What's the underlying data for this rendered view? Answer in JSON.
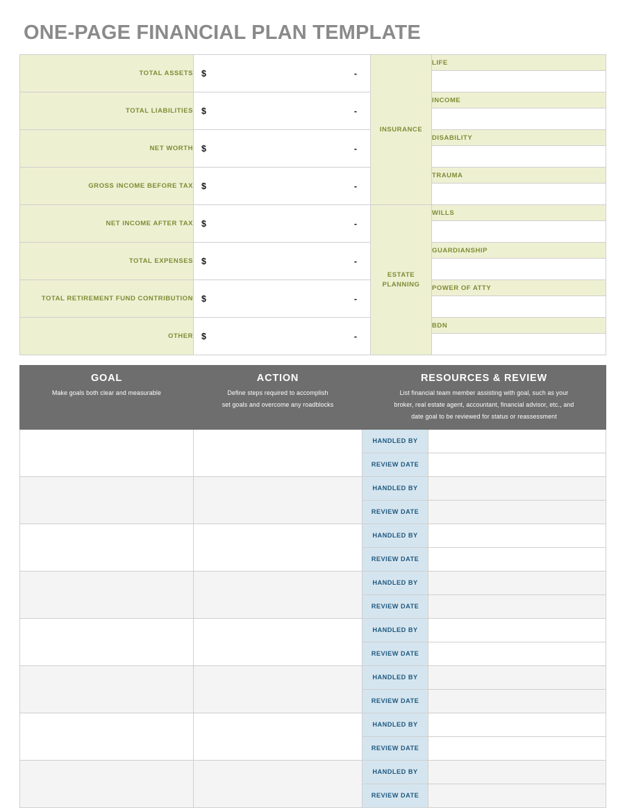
{
  "document": {
    "title": "ONE-PAGE FINANCIAL PLAN TEMPLATE"
  },
  "colors": {
    "olive_text": "#7d8c33",
    "olive_fill": "#eef0d2",
    "header_gray": "#6e6e6e",
    "title_gray": "#8a8a8a",
    "blue_fill": "#d5e5ef",
    "blue_text": "#1f587f",
    "stripe_gray": "#f4f4f4",
    "border": "#cfcfcf"
  },
  "summary": {
    "rows": [
      {
        "label": "TOTAL ASSETS",
        "currency": "$",
        "value": "-"
      },
      {
        "label": "TOTAL LIABILITIES",
        "currency": "$",
        "value": "-"
      },
      {
        "label": "NET WORTH",
        "currency": "$",
        "value": "-"
      },
      {
        "label": "GROSS INCOME BEFORE TAX",
        "currency": "$",
        "value": "-"
      },
      {
        "label": "NET INCOME AFTER TAX",
        "currency": "$",
        "value": "-"
      },
      {
        "label": "TOTAL EXPENSES",
        "currency": "$",
        "value": "-"
      },
      {
        "label": "TOTAL RETIREMENT FUND CONTRIBUTION",
        "currency": "$",
        "value": "-"
      },
      {
        "label": "OTHER",
        "currency": "$",
        "value": "-"
      }
    ]
  },
  "side_sections": [
    {
      "name": "INSURANCE",
      "name_line1": "INSURANCE",
      "name_line2": "",
      "items": [
        {
          "label": "LIFE",
          "value": ""
        },
        {
          "label": "INCOME",
          "value": ""
        },
        {
          "label": "DISABILITY",
          "value": ""
        },
        {
          "label": "TRAUMA",
          "value": ""
        }
      ]
    },
    {
      "name": "ESTATE PLANNING",
      "name_line1": "ESTATE",
      "name_line2": "PLANNING",
      "items": [
        {
          "label": "WILLS",
          "value": ""
        },
        {
          "label": "GUARDIANSHIP",
          "value": ""
        },
        {
          "label": "POWER OF ATTY",
          "value": ""
        },
        {
          "label": "BDN",
          "value": ""
        }
      ]
    }
  ],
  "goals_table": {
    "headers": [
      {
        "title": "GOAL",
        "subtitle_lines": [
          "Make goals both clear and measurable"
        ]
      },
      {
        "title": "ACTION",
        "subtitle_lines": [
          "Define steps required to accomplish",
          "set goals and overcome any roadblocks"
        ]
      },
      {
        "title": "RESOURCES & REVIEW",
        "subtitle_lines": [
          "List financial team member assisting with goal, such as your",
          "broker, real estate agent, accountant, financial advisor, etc., and",
          "date goal to be reviewed for status or reassessment"
        ]
      }
    ],
    "sub_labels": {
      "handled_by": "HANDLED BY",
      "review_date": "REVIEW DATE"
    },
    "rows": [
      {
        "goal": "",
        "action": "",
        "handled_by": "",
        "review_date": ""
      },
      {
        "goal": "",
        "action": "",
        "handled_by": "",
        "review_date": ""
      },
      {
        "goal": "",
        "action": "",
        "handled_by": "",
        "review_date": ""
      },
      {
        "goal": "",
        "action": "",
        "handled_by": "",
        "review_date": ""
      },
      {
        "goal": "",
        "action": "",
        "handled_by": "",
        "review_date": ""
      },
      {
        "goal": "",
        "action": "",
        "handled_by": "",
        "review_date": ""
      },
      {
        "goal": "",
        "action": "",
        "handled_by": "",
        "review_date": ""
      },
      {
        "goal": "",
        "action": "",
        "handled_by": "",
        "review_date": ""
      }
    ]
  }
}
